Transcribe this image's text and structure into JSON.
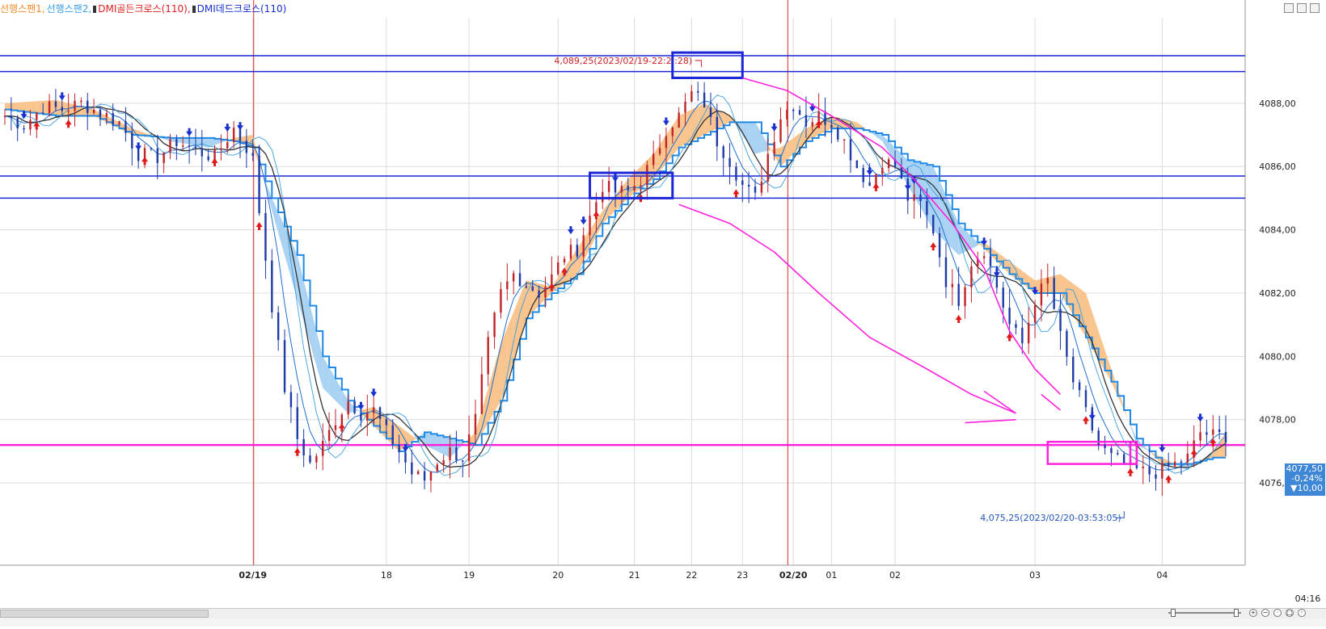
{
  "legend": {
    "items": [
      {
        "label": "선행스팬1",
        "color": "#f28c28"
      },
      {
        "label": "선행스팬2",
        "color": "#3a9ee8"
      },
      {
        "label": "DMI골든크로스(110)",
        "color": "#e02020"
      },
      {
        "label": "DMI데드크로스(110)",
        "color": "#1a2fd0"
      }
    ],
    "separator": ","
  },
  "colors": {
    "span1_fill": "#f9c48d",
    "span2_fill": "#a9d2f3",
    "span2_line": "#1e88e5",
    "up_bar": "#c0242b",
    "down_bar": "#1e3aa8",
    "thin_line": "#1f6fd0",
    "dark_line": "#333333",
    "hline_blue": "#1b26d9",
    "magenta": "#ff22dd",
    "grid": "#dcdcdc",
    "session_line": "#e02626",
    "axis_text": "#222222",
    "annotation_text": "#cc2222",
    "annotation_text_low": "#2255bb"
  },
  "annotations": {
    "high_label": "4,089,25(2023/02/19-22:2 :28)",
    "low_label": "4,075,25(2023/02/20-03:53:05)"
  },
  "last_price": {
    "price": "4077,50",
    "change": "-0,24%",
    "points": "▼10,00"
  },
  "time_label": "04:16",
  "chart_data": {
    "type": "candlestick",
    "title": "",
    "series": [
      {
        "name": "선행스팬1"
      },
      {
        "name": "선행스팬2"
      },
      {
        "name": "DMI골든크로스(110)"
      },
      {
        "name": "DMI데드크로스(110)"
      }
    ],
    "y_ticks": [
      "4088,00",
      "4086,00",
      "4084,00",
      "4082,00",
      "4080,00",
      "4078,00",
      "4076,00"
    ],
    "y_tick_values": [
      4088,
      4086,
      4084,
      4082,
      4080,
      4078,
      4076
    ],
    "ylim": [
      4073.4,
      4090.7
    ],
    "x_labels": [
      "02/19",
      "18",
      "19",
      "20",
      "21",
      "22",
      "23",
      "02/20",
      "01",
      "02",
      "03",
      "04"
    ],
    "x_label_bold": [
      true,
      false,
      false,
      false,
      false,
      false,
      false,
      true,
      false,
      false,
      false,
      false
    ],
    "x_label_index": [
      39,
      60,
      73,
      87,
      99,
      108,
      116,
      124,
      130,
      140,
      162,
      182
    ],
    "n_bars": 193,
    "session_breaks_index": [
      39,
      123
    ],
    "horizontal_levels": [
      4089.5,
      4089.0,
      4085.7,
      4085.0
    ],
    "support_level": 4077.2,
    "highlight_boxes": [
      {
        "i0": 105,
        "i1": 116,
        "y0": 4088.8,
        "y1": 4089.6,
        "color": "blue"
      },
      {
        "i0": 92,
        "i1": 105,
        "y0": 4085.0,
        "y1": 4085.8,
        "color": "blue"
      },
      {
        "i0": 164,
        "i1": 178,
        "y0": 4076.6,
        "y1": 4077.3,
        "color": "magenta"
      },
      {
        "i0": 177,
        "i1": 178,
        "y0": 4076.6,
        "y1": 4077.3,
        "color": "magenta"
      }
    ],
    "magenta_paths": [
      [
        [
          116,
          4088.8
        ],
        [
          123,
          4088.4
        ],
        [
          130,
          4087.6
        ],
        [
          138,
          4086.6
        ],
        [
          143,
          4085.6
        ],
        [
          149,
          4084.2
        ],
        [
          154,
          4082.8
        ],
        [
          158,
          4080.8
        ],
        [
          162,
          4079.6
        ],
        [
          166,
          4078.8
        ]
      ],
      [
        [
          106,
          4084.8
        ],
        [
          114,
          4084.2
        ],
        [
          121,
          4083.3
        ],
        [
          128,
          4082.0
        ],
        [
          136,
          4080.6
        ],
        [
          145,
          4079.6
        ],
        [
          152,
          4078.8
        ],
        [
          159,
          4078.2
        ]
      ],
      [
        [
          151,
          4077.9
        ],
        [
          159,
          4078.0
        ]
      ],
      [
        [
          154,
          4078.9
        ],
        [
          159,
          4078.2
        ]
      ],
      [
        [
          163,
          4078.8
        ],
        [
          166,
          4078.3
        ]
      ]
    ],
    "close_anchors": [
      [
        0,
        4087.6
      ],
      [
        3,
        4087.3
      ],
      [
        6,
        4087.9
      ],
      [
        9,
        4087.8
      ],
      [
        12,
        4088.0
      ],
      [
        15,
        4087.7
      ],
      [
        18,
        4087.4
      ],
      [
        21,
        4086.4
      ],
      [
        24,
        4086.3
      ],
      [
        27,
        4086.8
      ],
      [
        30,
        4086.5
      ],
      [
        33,
        4086.3
      ],
      [
        36,
        4087.2
      ],
      [
        38,
        4086.6
      ],
      [
        39,
        4086.2
      ],
      [
        40,
        4084.6
      ],
      [
        42,
        4081.6
      ],
      [
        44,
        4079.0
      ],
      [
        46,
        4077.4
      ],
      [
        48,
        4076.6
      ],
      [
        50,
        4077.2
      ],
      [
        52,
        4078.0
      ],
      [
        54,
        4078.6
      ],
      [
        56,
        4078.2
      ],
      [
        58,
        4078.3
      ],
      [
        60,
        4077.6
      ],
      [
        62,
        4077.0
      ],
      [
        64,
        4076.3
      ],
      [
        66,
        4076.1
      ],
      [
        68,
        4076.7
      ],
      [
        70,
        4077.0
      ],
      [
        72,
        4076.8
      ],
      [
        74,
        4078.0
      ],
      [
        76,
        4080.4
      ],
      [
        78,
        4082.0
      ],
      [
        80,
        4082.6
      ],
      [
        82,
        4082.3
      ],
      [
        84,
        4082.0
      ],
      [
        86,
        4082.5
      ],
      [
        88,
        4083.2
      ],
      [
        90,
        4083.4
      ],
      [
        92,
        4084.4
      ],
      [
        94,
        4085.4
      ],
      [
        96,
        4085.2
      ],
      [
        98,
        4085.2
      ],
      [
        100,
        4085.6
      ],
      [
        102,
        4086.2
      ],
      [
        104,
        4087.2
      ],
      [
        106,
        4087.6
      ],
      [
        108,
        4088.3
      ],
      [
        110,
        4088.0
      ],
      [
        112,
        4086.8
      ],
      [
        114,
        4086.2
      ],
      [
        116,
        4085.4
      ],
      [
        118,
        4085.0
      ],
      [
        120,
        4086.4
      ],
      [
        122,
        4087.6
      ],
      [
        124,
        4088.0
      ],
      [
        126,
        4087.4
      ],
      [
        128,
        4087.6
      ],
      [
        130,
        4087.4
      ],
      [
        132,
        4086.8
      ],
      [
        134,
        4086.0
      ],
      [
        136,
        4085.4
      ],
      [
        138,
        4086.2
      ],
      [
        140,
        4086.0
      ],
      [
        142,
        4085.0
      ],
      [
        144,
        4084.8
      ],
      [
        146,
        4084.0
      ],
      [
        148,
        4082.4
      ],
      [
        150,
        4081.8
      ],
      [
        152,
        4083.0
      ],
      [
        154,
        4083.4
      ],
      [
        156,
        4082.2
      ],
      [
        158,
        4081.0
      ],
      [
        160,
        4080.4
      ],
      [
        162,
        4081.8
      ],
      [
        164,
        4082.4
      ],
      [
        166,
        4080.6
      ],
      [
        168,
        4079.2
      ],
      [
        170,
        4078.2
      ],
      [
        172,
        4077.2
      ],
      [
        174,
        4076.8
      ],
      [
        176,
        4076.6
      ],
      [
        178,
        4076.4
      ],
      [
        180,
        4076.3
      ],
      [
        182,
        4076.4
      ],
      [
        184,
        4076.6
      ],
      [
        186,
        4076.8
      ],
      [
        188,
        4077.6
      ],
      [
        190,
        4077.5
      ],
      [
        192,
        4077.5
      ]
    ],
    "span1_anchors": [
      [
        0,
        4088.0
      ],
      [
        8,
        4088.1
      ],
      [
        14,
        4087.8
      ],
      [
        20,
        4087.2
      ],
      [
        26,
        4086.8
      ],
      [
        32,
        4086.6
      ],
      [
        36,
        4086.9
      ],
      [
        39,
        4087.0
      ],
      [
        42,
        4084.6
      ],
      [
        46,
        4081.8
      ],
      [
        50,
        4079.0
      ],
      [
        54,
        4078.2
      ],
      [
        58,
        4078.4
      ],
      [
        62,
        4077.8
      ],
      [
        66,
        4077.2
      ],
      [
        70,
        4076.8
      ],
      [
        74,
        4077.6
      ],
      [
        78,
        4080.4
      ],
      [
        82,
        4082.4
      ],
      [
        86,
        4082.2
      ],
      [
        90,
        4083.4
      ],
      [
        94,
        4084.6
      ],
      [
        98,
        4085.6
      ],
      [
        102,
        4086.4
      ],
      [
        106,
        4087.6
      ],
      [
        110,
        4088.0
      ],
      [
        114,
        4087.6
      ],
      [
        118,
        4086.4
      ],
      [
        122,
        4086.6
      ],
      [
        126,
        4087.2
      ],
      [
        130,
        4087.6
      ],
      [
        134,
        4087.4
      ],
      [
        138,
        4086.8
      ],
      [
        142,
        4085.4
      ],
      [
        146,
        4084.0
      ],
      [
        150,
        4083.2
      ],
      [
        154,
        4083.6
      ],
      [
        158,
        4083.0
      ],
      [
        162,
        4082.4
      ],
      [
        166,
        4082.6
      ],
      [
        170,
        4082.0
      ],
      [
        174,
        4079.6
      ],
      [
        178,
        4077.2
      ],
      [
        182,
        4076.8
      ],
      [
        186,
        4076.4
      ],
      [
        190,
        4077.0
      ],
      [
        192,
        4077.6
      ]
    ],
    "span2_anchors": [
      [
        0,
        4087.8
      ],
      [
        8,
        4087.6
      ],
      [
        14,
        4087.6
      ],
      [
        20,
        4087.0
      ],
      [
        26,
        4086.9
      ],
      [
        32,
        4086.9
      ],
      [
        36,
        4086.8
      ],
      [
        39,
        4086.6
      ],
      [
        42,
        4085.0
      ],
      [
        46,
        4083.2
      ],
      [
        50,
        4080.0
      ],
      [
        54,
        4078.6
      ],
      [
        58,
        4077.8
      ],
      [
        62,
        4077.0
      ],
      [
        66,
        4077.6
      ],
      [
        70,
        4077.4
      ],
      [
        74,
        4077.2
      ],
      [
        78,
        4078.6
      ],
      [
        82,
        4081.2
      ],
      [
        86,
        4082.0
      ],
      [
        90,
        4082.6
      ],
      [
        94,
        4084.2
      ],
      [
        98,
        4085.0
      ],
      [
        102,
        4085.6
      ],
      [
        106,
        4086.6
      ],
      [
        110,
        4087.0
      ],
      [
        114,
        4087.4
      ],
      [
        118,
        4087.4
      ],
      [
        122,
        4086.0
      ],
      [
        126,
        4086.8
      ],
      [
        130,
        4087.2
      ],
      [
        134,
        4087.2
      ],
      [
        138,
        4087.0
      ],
      [
        142,
        4086.2
      ],
      [
        146,
        4086.0
      ],
      [
        150,
        4084.2
      ],
      [
        154,
        4083.4
      ],
      [
        158,
        4082.6
      ],
      [
        162,
        4082.0
      ],
      [
        166,
        4082.0
      ],
      [
        170,
        4080.6
      ],
      [
        174,
        4079.2
      ],
      [
        178,
        4077.4
      ],
      [
        182,
        4076.6
      ],
      [
        186,
        4076.6
      ],
      [
        190,
        4076.8
      ],
      [
        192,
        4076.8
      ]
    ],
    "golden_cross_index": [
      5,
      10,
      22,
      33,
      40,
      46,
      53,
      86,
      88,
      93,
      100,
      115,
      128,
      137,
      146,
      150,
      158,
      170,
      177,
      183,
      187,
      190
    ],
    "dead_cross_index": [
      3,
      9,
      21,
      29,
      35,
      37,
      56,
      58,
      63,
      89,
      91,
      96,
      104,
      121,
      127,
      136,
      142,
      143,
      154,
      156,
      162,
      171,
      182,
      188
    ]
  }
}
